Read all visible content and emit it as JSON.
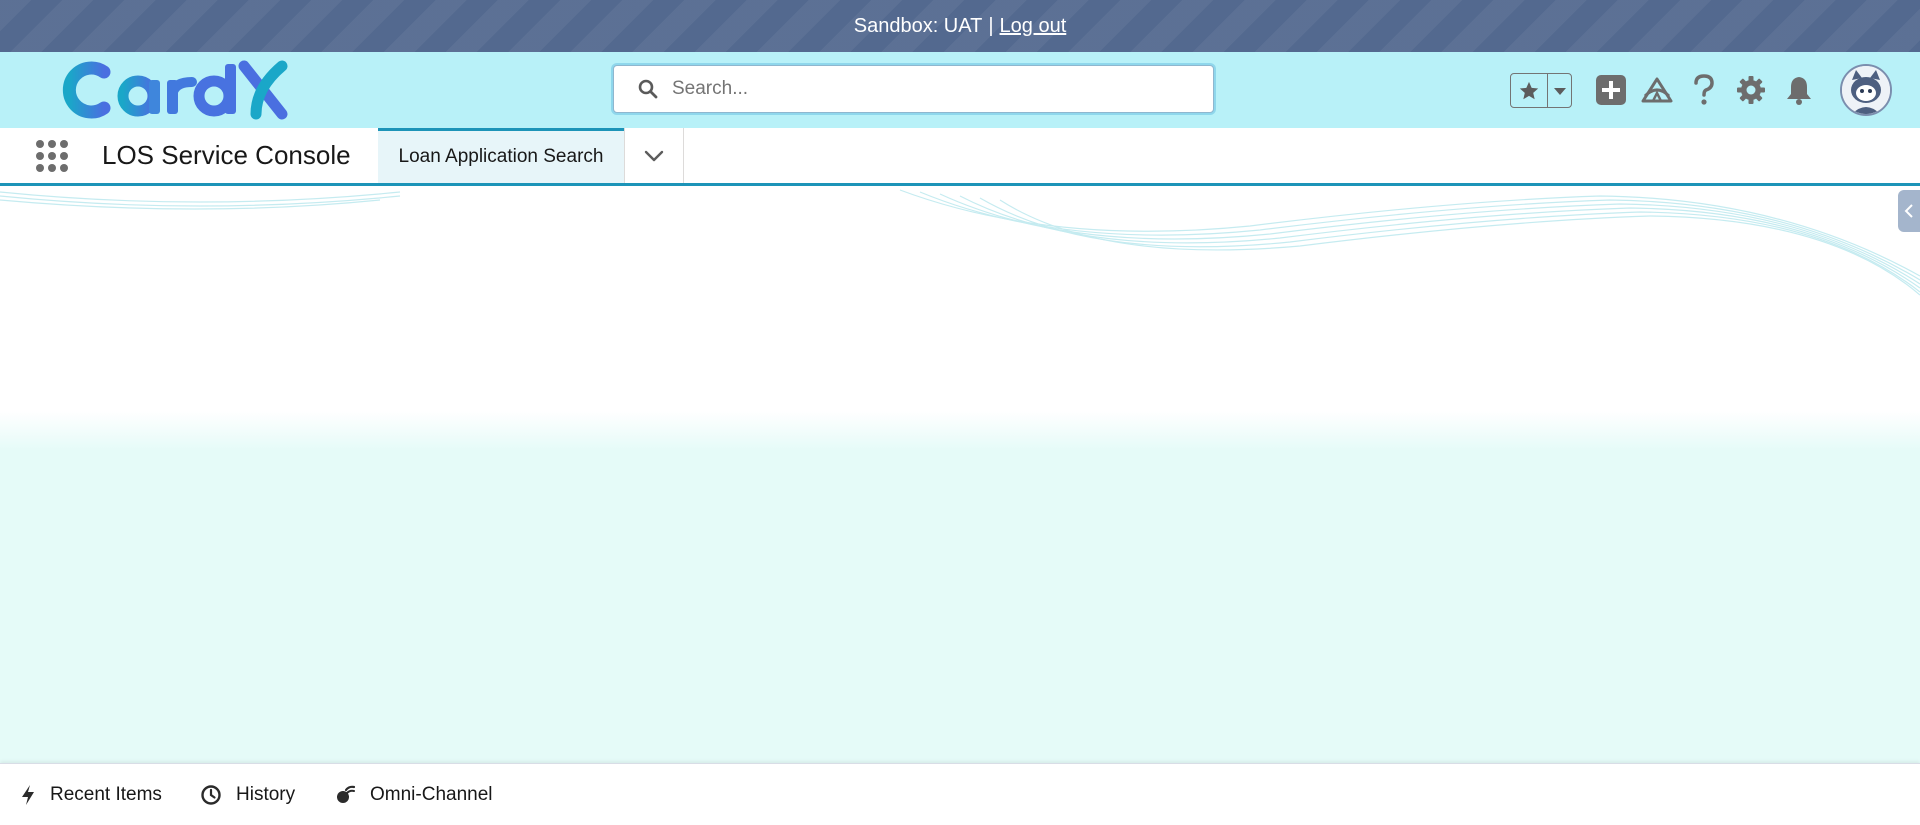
{
  "sandbox_bar": {
    "text": "Sandbox: UAT",
    "separator": "|",
    "logout_label": "Log out"
  },
  "header": {
    "logo_text": "CardX",
    "search": {
      "placeholder": "Search...",
      "value": ""
    },
    "icons": [
      "favorites-star-icon",
      "favorites-dropdown-icon",
      "add-icon",
      "trailhead-icon",
      "help-icon",
      "setup-gear-icon",
      "notifications-bell-icon",
      "avatar"
    ]
  },
  "nav": {
    "app_name": "LOS Service Console",
    "tabs": [
      {
        "label": "Loan Application Search",
        "active": true
      }
    ]
  },
  "utility_bar": {
    "items": [
      {
        "label": "Recent Items",
        "icon": "lightning-icon"
      },
      {
        "label": "History",
        "icon": "clock-icon"
      },
      {
        "label": "Omni-Channel",
        "icon": "omni-channel-icon"
      }
    ]
  },
  "colors": {
    "sandbox_bar": "#53698f",
    "header_bg": "#b8f1f8",
    "accent": "#1c94b8",
    "content_bg": "#e5fbf8",
    "icon_gray": "#747474"
  }
}
